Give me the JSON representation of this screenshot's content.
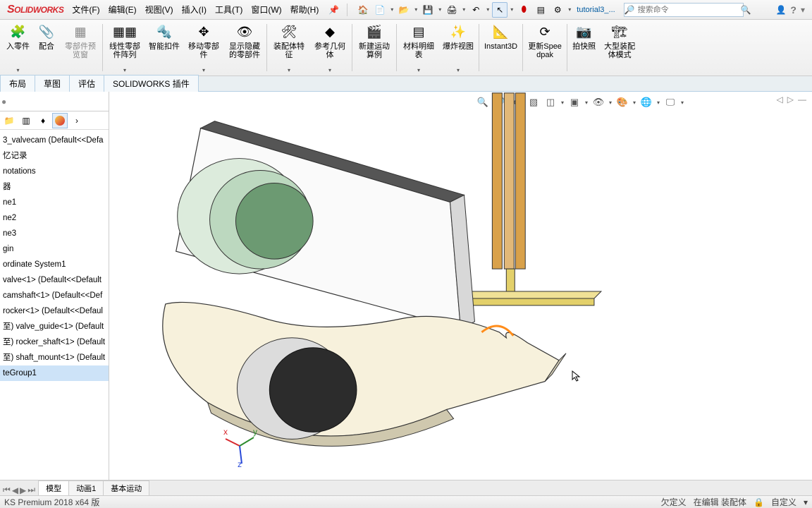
{
  "app": {
    "logo_pre": "S",
    "logo_rest": "OLIDWORKS"
  },
  "menu": {
    "file": "文件(F)",
    "edit": "编辑(E)",
    "view": "视图(V)",
    "insert": "插入(I)",
    "tool": "工具(T)",
    "window": "窗口(W)",
    "help": "帮助(H)"
  },
  "doc_name": "tutorial3_...",
  "search": {
    "placeholder": "搜索命令",
    "icon": "🔍"
  },
  "ribbon": {
    "insertpart": "入零件",
    "mate": "配合",
    "preview": "零部件预览窗",
    "linear": "线性零部件阵列",
    "smart": "智能扣件",
    "move": "移动零部件",
    "showhide": "显示隐藏的零部件",
    "assyfeat": "装配体特征",
    "refgeo": "参考几何体",
    "motion": "新建运动算例",
    "bom": "材料明细表",
    "explode": "爆炸视图",
    "instant": "Instant3D",
    "speedpak": "更新Speedpak",
    "snapshot": "拍快照",
    "large": "大型装配体模式"
  },
  "tabs": {
    "layout": "布局",
    "sketch": "草图",
    "eval": "评估",
    "addin": "SOLIDWORKS 插件"
  },
  "tree": [
    "3_valvecam  (Default<<Defa",
    "忆记录",
    "notations",
    "器",
    "ne1",
    "ne2",
    "ne3",
    "gin",
    "ordinate System1",
    "valve<1> (Default<<Default",
    "camshaft<1> (Default<<Def",
    "rocker<1> (Default<<Defaul",
    "至) valve_guide<1> (Default",
    "至) rocker_shaft<1> (Default",
    "至) shaft_mount<1> (Default",
    "teGroup1"
  ],
  "btabs": {
    "model": "模型",
    "motion1": "动画1",
    "basicmotion": "基本运动"
  },
  "status": {
    "version": "KS Premium 2018 x64 版",
    "under": "欠定义",
    "editing": "在编辑 装配体",
    "custom": "自定义"
  },
  "triad": {
    "x": "x",
    "y": "y",
    "z": "z"
  }
}
